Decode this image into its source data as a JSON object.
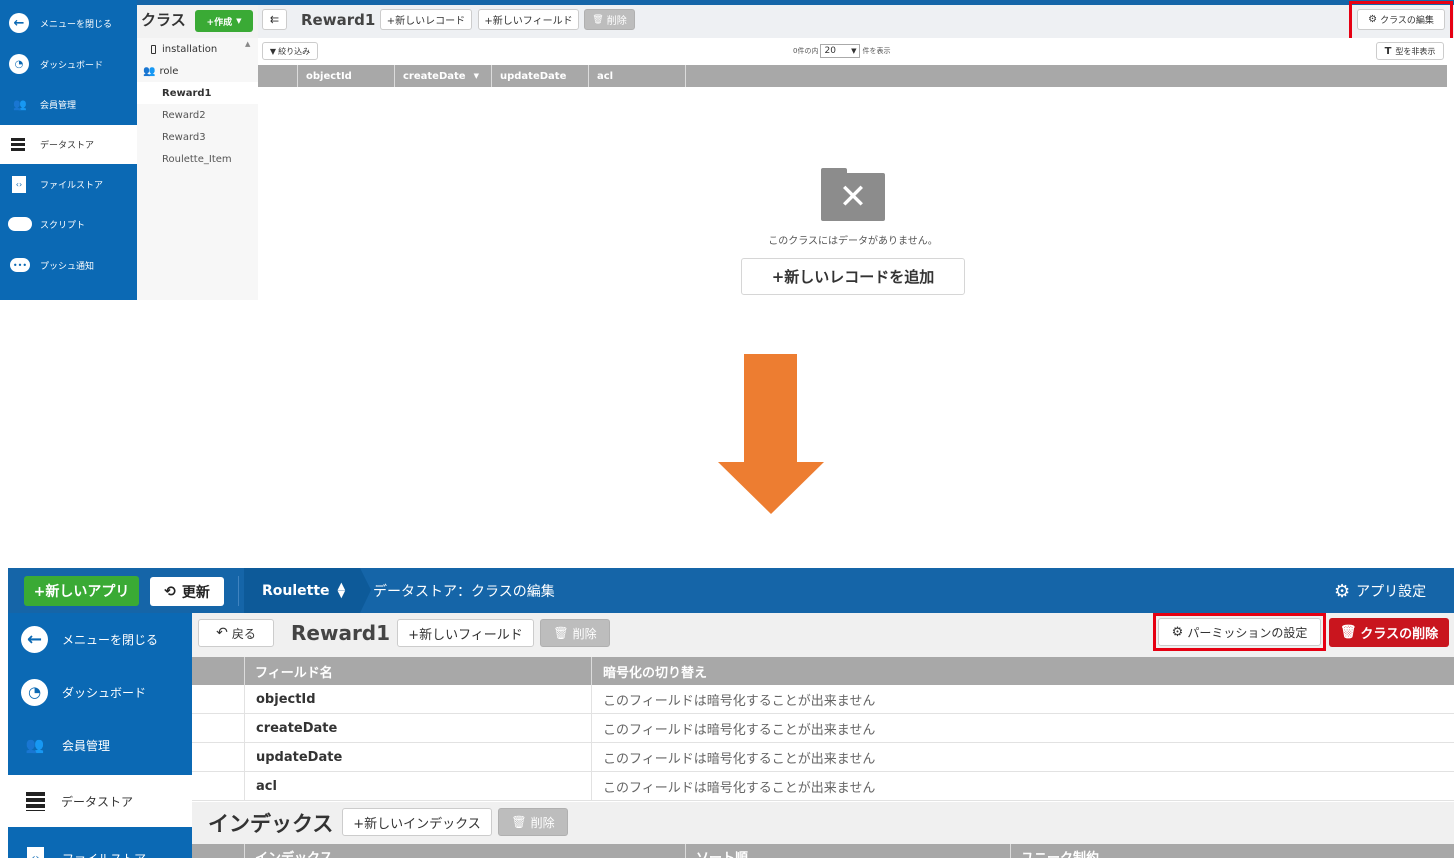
{
  "top": {
    "sidebar": {
      "items": [
        {
          "label": "メニューを閉じる",
          "icon": "arrow-left-icon"
        },
        {
          "label": "ダッシュボード",
          "icon": "gauge-icon"
        },
        {
          "label": "会員管理",
          "icon": "users-icon"
        },
        {
          "label": "データストア",
          "icon": "database-icon",
          "active": true
        },
        {
          "label": "ファイルストア",
          "icon": "file-icon"
        },
        {
          "label": "スクリプト",
          "icon": "cloud-icon"
        },
        {
          "label": "プッシュ通知",
          "icon": "chat-icon"
        }
      ]
    },
    "classes": {
      "title": "クラス",
      "create_label": "+作成",
      "items": [
        {
          "label": "installation",
          "icon": "mobile-icon"
        },
        {
          "label": "role",
          "icon": "users-icon"
        },
        {
          "label": "Reward1",
          "selected": true
        },
        {
          "label": "Reward2"
        },
        {
          "label": "Reward3"
        },
        {
          "label": "Roulette_Item"
        }
      ]
    },
    "toolbar": {
      "collapse_icon": "collapse-icon",
      "class_name": "Reward1",
      "new_record_label": "+新しいレコード",
      "new_field_label": "+新しいフィールド",
      "delete_label": "削除",
      "edit_class_label": "クラスの編集"
    },
    "filter": {
      "filter_label": "絞り込み",
      "count_prefix": "0件の内",
      "page_size": "20",
      "count_suffix": "件を表示",
      "hide_types_label": "型を非表示"
    },
    "table": {
      "columns": [
        "objectId",
        "createDate",
        "updateDate",
        "acl"
      ]
    },
    "empty": {
      "message": "このクラスにはデータがありません。",
      "add_record_label": "+新しいレコードを追加"
    }
  },
  "arrow": {
    "color": "#ed7d31"
  },
  "bottom": {
    "header": {
      "new_app_label": "+新しいアプリ",
      "refresh_label": "更新",
      "app_name": "Roulette",
      "breadcrumb": "データストア：クラスの編集",
      "app_settings_label": "アプリ設定"
    },
    "sidebar": {
      "items": [
        {
          "label": "メニューを閉じる",
          "icon": "arrow-left-icon"
        },
        {
          "label": "ダッシュボード",
          "icon": "gauge-icon"
        },
        {
          "label": "会員管理",
          "icon": "users-icon"
        },
        {
          "label": "データストア",
          "icon": "database-icon",
          "active": true
        },
        {
          "label": "ファイルストア",
          "icon": "file-icon"
        }
      ]
    },
    "toolbar": {
      "back_label": "戻る",
      "class_name": "Reward1",
      "new_field_label": "+新しいフィールド",
      "delete_label": "削除",
      "permission_label": "パーミッションの設定",
      "delete_class_label": "クラスの削除"
    },
    "fields_table": {
      "headers": [
        "フィールド名",
        "暗号化の切り替え"
      ],
      "rows": [
        {
          "name": "objectId",
          "encryption": "このフィールドは暗号化することが出来ません"
        },
        {
          "name": "createDate",
          "encryption": "このフィールドは暗号化することが出来ません"
        },
        {
          "name": "updateDate",
          "encryption": "このフィールドは暗号化することが出来ません"
        },
        {
          "name": "acl",
          "encryption": "このフィールドは暗号化することが出来ません"
        }
      ]
    },
    "index": {
      "title": "インデックス",
      "new_index_label": "+新しいインデックス",
      "delete_label": "削除",
      "headers": [
        "インデックス",
        "ソート順",
        "ユニーク制約"
      ]
    }
  },
  "colors": {
    "sidebar_blue": "#0b69b4",
    "header_blue": "#1565a8",
    "green": "#3aaa35",
    "red_highlight": "#e60012",
    "delete_red": "#c9151e",
    "table_header_gray": "#a8a8a8"
  }
}
